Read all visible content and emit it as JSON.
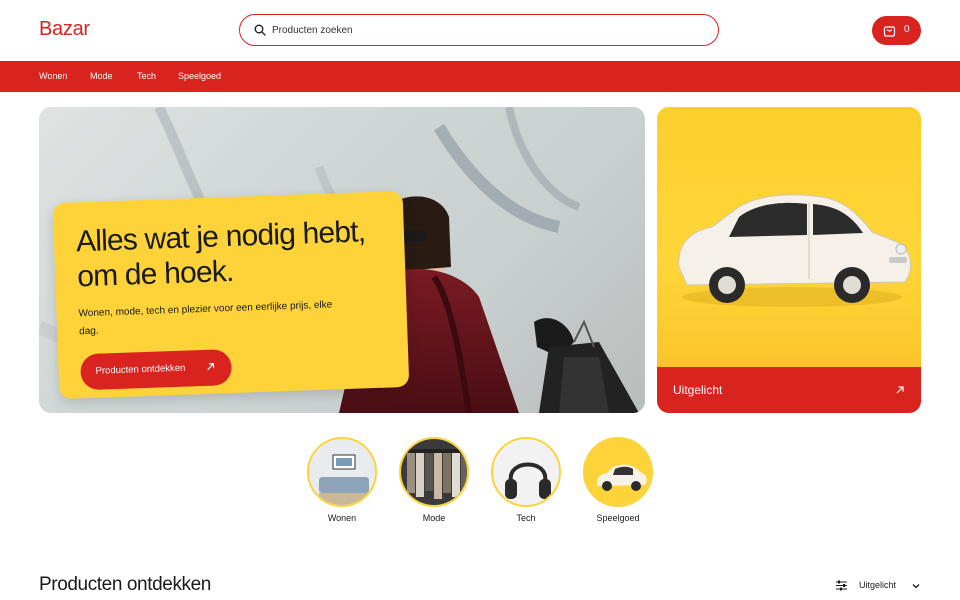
{
  "header": {
    "logo": "Bazar",
    "search_placeholder": "Producten zoeken",
    "cart_count": "0"
  },
  "nav": {
    "items": [
      "Wonen",
      "Mode",
      "Tech",
      "Speelgoed"
    ]
  },
  "hero": {
    "title": "Alles wat je nodig hebt, om de hoek.",
    "subtitle": "Wonen, mode, tech en plezier voor een eerlijke prijs, elke dag.",
    "cta_label": "Producten ontdekken"
  },
  "featured": {
    "label": "Uitgelicht"
  },
  "categories": [
    {
      "label": "Wonen"
    },
    {
      "label": "Mode"
    },
    {
      "label": "Tech"
    },
    {
      "label": "Speelgoed"
    }
  ],
  "products": {
    "title": "Producten ontdekken",
    "sort_label": "Uitgelicht"
  },
  "colors": {
    "brand_red": "#d8231f",
    "accent_yellow": "#fdd339",
    "text_dark": "#1a1a1a"
  },
  "icons": {
    "search": "search-icon",
    "cart": "shopping-bag-icon",
    "arrow": "arrow-up-right-icon",
    "sort": "sliders-icon",
    "chevron": "chevron-down-icon"
  }
}
